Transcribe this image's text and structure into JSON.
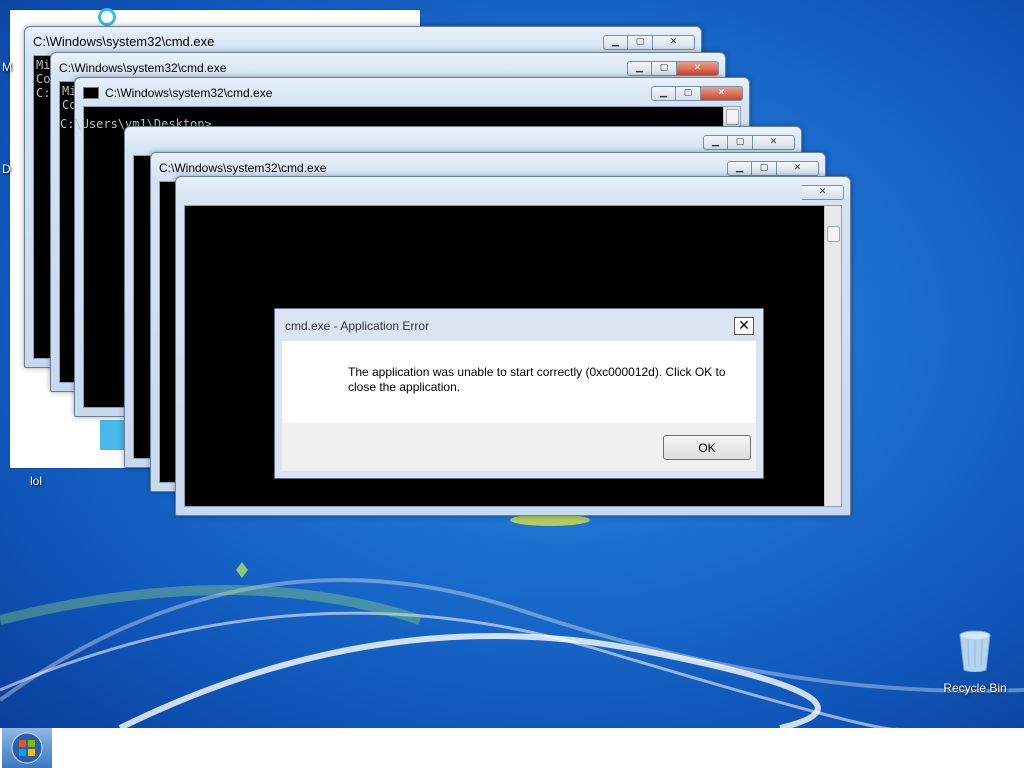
{
  "desktop": {
    "labels": {
      "lol": "lol",
      "partial_m": "M",
      "partial_d": "D"
    },
    "recycle_bin_label": "Recycle Bin"
  },
  "cmd_windows": [
    {
      "title": "C:\\Windows\\system32\\cmd.exe",
      "console_lines": [
        "Mi",
        "Co",
        "",
        "C:"
      ]
    },
    {
      "title": "C:\\Windows\\system32\\cmd.exe",
      "console_lines": [
        "Mi",
        "Co"
      ]
    },
    {
      "title": "C:\\Windows\\system32\\cmd.exe",
      "console_lines": [
        "C:\\Users\\vm1\\Desktop>"
      ]
    },
    {
      "title": "C:\\Windows\\system32\\cmd.exe",
      "console_lines": []
    }
  ],
  "dialog": {
    "title": "cmd.exe - Application Error",
    "message": "The application was unable to start correctly (0xc000012d). Click OK to close the application.",
    "ok_label": "OK",
    "close_glyph": "✕"
  },
  "window_buttons": {
    "minimize": "▁",
    "maximize": "▢",
    "close": "✕"
  },
  "taskbar": {
    "start_icon": "windows-logo-icon"
  }
}
